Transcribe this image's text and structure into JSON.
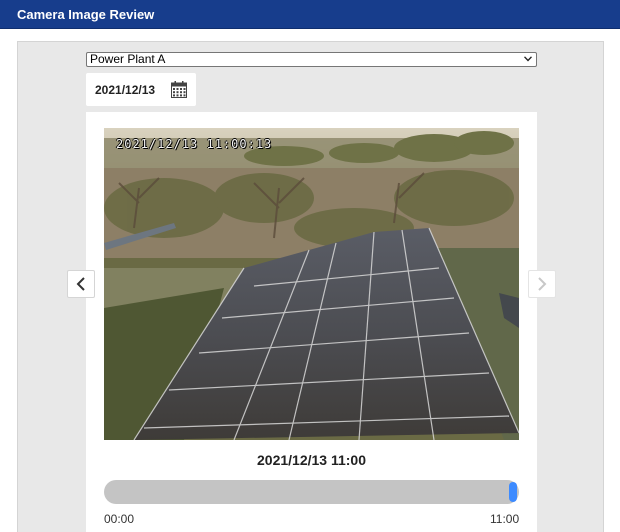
{
  "app": {
    "title": "Camera Image Review"
  },
  "controls": {
    "site_select": {
      "selected": "Power Plant A"
    },
    "date": {
      "value": "2021/12/13"
    }
  },
  "viewer": {
    "overlay_timestamp": "2021/12/13  11:00:13",
    "caption": "2021/12/13 11:00",
    "prev_icon": "chevron-left-icon",
    "next_icon": "chevron-right-icon",
    "next_enabled": false
  },
  "timeline": {
    "start_label": "00:00",
    "end_label": "11:00",
    "position": 1.0
  },
  "colors": {
    "header": "#173d8c",
    "slider_thumb": "#3d8bff",
    "slider_track": "#c4c4c4"
  }
}
